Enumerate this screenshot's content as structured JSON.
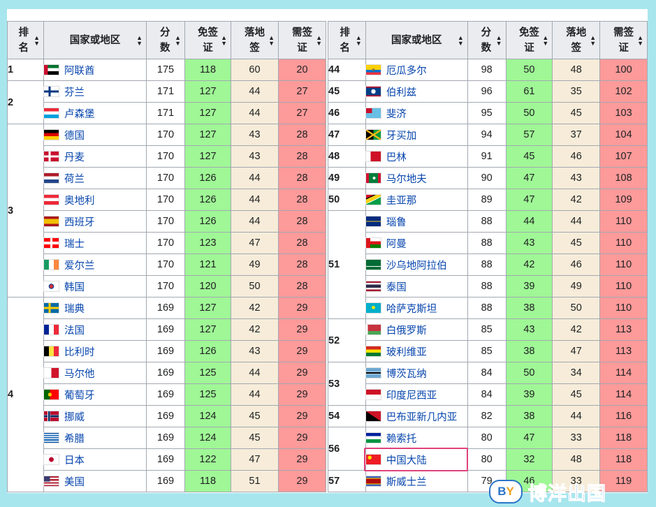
{
  "headers": {
    "rank": "排名",
    "country": "国家或地区",
    "score": "分数",
    "visa_free": "免签证",
    "visa_on_arrival": "落地签",
    "visa_required": "需签证"
  },
  "colors": {
    "visa_free": "#9ff796",
    "visa_on_arrival": "#f6ecd9",
    "visa_required": "#fd9a9a",
    "highlight_border": "#e0427b",
    "link": "#0645ad"
  },
  "left_table": [
    {
      "rank": "1",
      "rows": [
        {
          "country": "阿联酋",
          "flag": "uae-flag",
          "score": "175",
          "vf": "118",
          "voa": "60",
          "vr": "20"
        }
      ]
    },
    {
      "rank": "2",
      "rows": [
        {
          "country": "芬兰",
          "flag": "finland-flag",
          "score": "171",
          "vf": "127",
          "voa": "44",
          "vr": "27"
        },
        {
          "country": "卢森堡",
          "flag": "luxembourg-flag",
          "score": "171",
          "vf": "127",
          "voa": "44",
          "vr": "27"
        }
      ]
    },
    {
      "rank": "3",
      "rows": [
        {
          "country": "德国",
          "flag": "germany-flag",
          "score": "170",
          "vf": "127",
          "voa": "43",
          "vr": "28"
        },
        {
          "country": "丹麦",
          "flag": "denmark-flag",
          "score": "170",
          "vf": "127",
          "voa": "43",
          "vr": "28"
        },
        {
          "country": "荷兰",
          "flag": "netherlands-flag",
          "score": "170",
          "vf": "126",
          "voa": "44",
          "vr": "28"
        },
        {
          "country": "奥地利",
          "flag": "austria-flag",
          "score": "170",
          "vf": "126",
          "voa": "44",
          "vr": "28"
        },
        {
          "country": "西班牙",
          "flag": "spain-flag",
          "score": "170",
          "vf": "126",
          "voa": "44",
          "vr": "28"
        },
        {
          "country": "瑞士",
          "flag": "switzerland-flag",
          "score": "170",
          "vf": "123",
          "voa": "47",
          "vr": "28"
        },
        {
          "country": "爱尔兰",
          "flag": "ireland-flag",
          "score": "170",
          "vf": "121",
          "voa": "49",
          "vr": "28"
        },
        {
          "country": "韩国",
          "flag": "south-korea-flag",
          "score": "170",
          "vf": "120",
          "voa": "50",
          "vr": "28"
        }
      ]
    },
    {
      "rank": "4",
      "rows": [
        {
          "country": "瑞典",
          "flag": "sweden-flag",
          "score": "169",
          "vf": "127",
          "voa": "42",
          "vr": "29"
        },
        {
          "country": "法国",
          "flag": "france-flag",
          "score": "169",
          "vf": "127",
          "voa": "42",
          "vr": "29"
        },
        {
          "country": "比利时",
          "flag": "belgium-flag",
          "score": "169",
          "vf": "126",
          "voa": "43",
          "vr": "29"
        },
        {
          "country": "马尔他",
          "flag": "malta-flag",
          "score": "169",
          "vf": "125",
          "voa": "44",
          "vr": "29"
        },
        {
          "country": "葡萄牙",
          "flag": "portugal-flag",
          "score": "169",
          "vf": "125",
          "voa": "44",
          "vr": "29"
        },
        {
          "country": "挪威",
          "flag": "norway-flag",
          "score": "169",
          "vf": "124",
          "voa": "45",
          "vr": "29"
        },
        {
          "country": "希腊",
          "flag": "greece-flag",
          "score": "169",
          "vf": "124",
          "voa": "45",
          "vr": "29"
        },
        {
          "country": "日本",
          "flag": "japan-flag",
          "score": "169",
          "vf": "122",
          "voa": "47",
          "vr": "29"
        },
        {
          "country": "美国",
          "flag": "usa-flag",
          "score": "169",
          "vf": "118",
          "voa": "51",
          "vr": "29"
        }
      ]
    }
  ],
  "right_table": [
    {
      "rank": "44",
      "rows": [
        {
          "country": "厄瓜多尔",
          "flag": "ecuador-flag",
          "score": "98",
          "vf": "50",
          "voa": "48",
          "vr": "100"
        }
      ]
    },
    {
      "rank": "45",
      "rows": [
        {
          "country": "伯利兹",
          "flag": "belize-flag",
          "score": "96",
          "vf": "61",
          "voa": "35",
          "vr": "102"
        }
      ]
    },
    {
      "rank": "46",
      "rows": [
        {
          "country": "斐济",
          "flag": "fiji-flag",
          "score": "95",
          "vf": "50",
          "voa": "45",
          "vr": "103"
        }
      ]
    },
    {
      "rank": "47",
      "rows": [
        {
          "country": "牙买加",
          "flag": "jamaica-flag",
          "score": "94",
          "vf": "57",
          "voa": "37",
          "vr": "104"
        }
      ]
    },
    {
      "rank": "48",
      "rows": [
        {
          "country": "巴林",
          "flag": "bahrain-flag",
          "score": "91",
          "vf": "45",
          "voa": "46",
          "vr": "107"
        }
      ]
    },
    {
      "rank": "49",
      "rows": [
        {
          "country": "马尔地夫",
          "flag": "maldives-flag",
          "score": "90",
          "vf": "47",
          "voa": "43",
          "vr": "108"
        }
      ]
    },
    {
      "rank": "50",
      "rows": [
        {
          "country": "圭亚那",
          "flag": "guyana-flag",
          "score": "89",
          "vf": "47",
          "voa": "42",
          "vr": "109"
        }
      ]
    },
    {
      "rank": "51",
      "rows": [
        {
          "country": "瑙鲁",
          "flag": "nauru-flag",
          "score": "88",
          "vf": "44",
          "voa": "44",
          "vr": "110"
        },
        {
          "country": "阿曼",
          "flag": "oman-flag",
          "score": "88",
          "vf": "43",
          "voa": "45",
          "vr": "110"
        },
        {
          "country": "沙乌地阿拉伯",
          "flag": "saudi-arabia-flag",
          "score": "88",
          "vf": "42",
          "voa": "46",
          "vr": "110"
        },
        {
          "country": "泰国",
          "flag": "thailand-flag",
          "score": "88",
          "vf": "39",
          "voa": "49",
          "vr": "110"
        },
        {
          "country": "哈萨克斯坦",
          "flag": "kazakhstan-flag",
          "score": "88",
          "vf": "38",
          "voa": "50",
          "vr": "110"
        }
      ]
    },
    {
      "rank": "52",
      "rows": [
        {
          "country": "白俄罗斯",
          "flag": "belarus-flag",
          "score": "85",
          "vf": "43",
          "voa": "42",
          "vr": "113"
        },
        {
          "country": "玻利维亚",
          "flag": "bolivia-flag",
          "score": "85",
          "vf": "38",
          "voa": "47",
          "vr": "113"
        }
      ]
    },
    {
      "rank": "53",
      "rows": [
        {
          "country": "博茨瓦纳",
          "flag": "botswana-flag",
          "score": "84",
          "vf": "50",
          "voa": "34",
          "vr": "114"
        },
        {
          "country": "印度尼西亚",
          "flag": "indonesia-flag",
          "score": "84",
          "vf": "39",
          "voa": "45",
          "vr": "114"
        }
      ]
    },
    {
      "rank": "54",
      "rows": [
        {
          "country": "巴布亚新几内亚",
          "flag": "papua-new-guinea-flag",
          "score": "82",
          "vf": "38",
          "voa": "44",
          "vr": "116"
        }
      ]
    },
    {
      "rank": "56",
      "rows": [
        {
          "country": "赖索托",
          "flag": "lesotho-flag",
          "score": "80",
          "vf": "47",
          "voa": "33",
          "vr": "118"
        },
        {
          "country": "中国大陆",
          "flag": "china-flag",
          "score": "80",
          "vf": "32",
          "voa": "48",
          "vr": "118",
          "highlighted": true
        }
      ]
    },
    {
      "rank": "57",
      "rows": [
        {
          "country": "斯威士兰",
          "flag": "eswatini-flag",
          "score": "79",
          "vf": "46",
          "voa": "33",
          "vr": "119"
        }
      ]
    }
  ],
  "watermark": {
    "logo_b": "B",
    "logo_y": "Y",
    "text": "博洋出国"
  }
}
